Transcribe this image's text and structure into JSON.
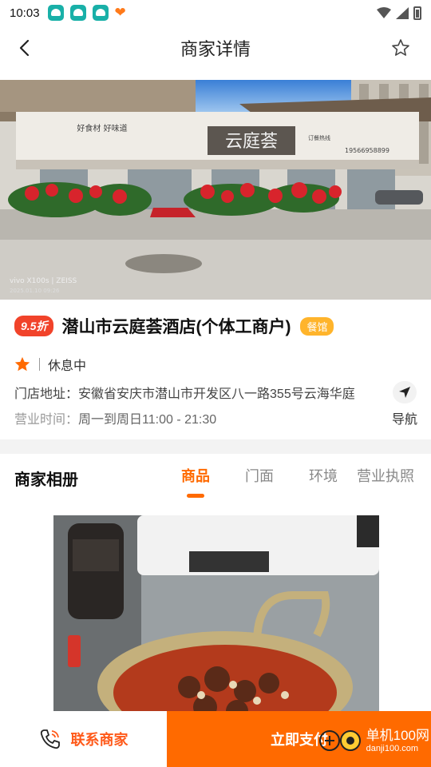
{
  "status_bar": {
    "time": "10:03",
    "app_icons": [
      "notification-app-icon",
      "notification-app-icon",
      "notification-app-icon"
    ],
    "extra_icon": "heart-app-icon"
  },
  "header": {
    "title": "商家详情",
    "back_icon": "chevron-left-icon",
    "favorite_icon": "star-outline-icon"
  },
  "store": {
    "discount": "9.5折",
    "name": "潜山市云庭荟酒店(个体工商户)",
    "category": "餐馆",
    "status": "休息中",
    "address_label": "门店地址：",
    "address": "安徽省安庆市潜山市开发区八一路355号云海华庭",
    "hours_label": "营业时间：",
    "hours": "周一到周日11:00 - 21:30",
    "nav_label": "导航",
    "photo_text": {
      "sign": "云庭荟",
      "slogan": "好食材  好味道",
      "hotline_label": "订餐热线",
      "phone": "19566958899",
      "camera_mark": "vivo X100s | ZEISS",
      "photo_date": "2025.01.10 09:26"
    }
  },
  "album": {
    "title": "商家相册",
    "tabs": [
      {
        "label": "商品",
        "active": true
      },
      {
        "label": "门面",
        "active": false
      },
      {
        "label": "环境",
        "active": false
      },
      {
        "label": "营业执照",
        "active": false
      }
    ]
  },
  "bottom_bar": {
    "contact_label": "联系商家",
    "pay_label": "立即支付",
    "watermark_title": "单机100网",
    "watermark_sub": "danji100.com"
  },
  "colors": {
    "accent": "#ff6a00",
    "discount": "#f1432a",
    "category": "#ffb42b",
    "star": "#ff6a00"
  }
}
